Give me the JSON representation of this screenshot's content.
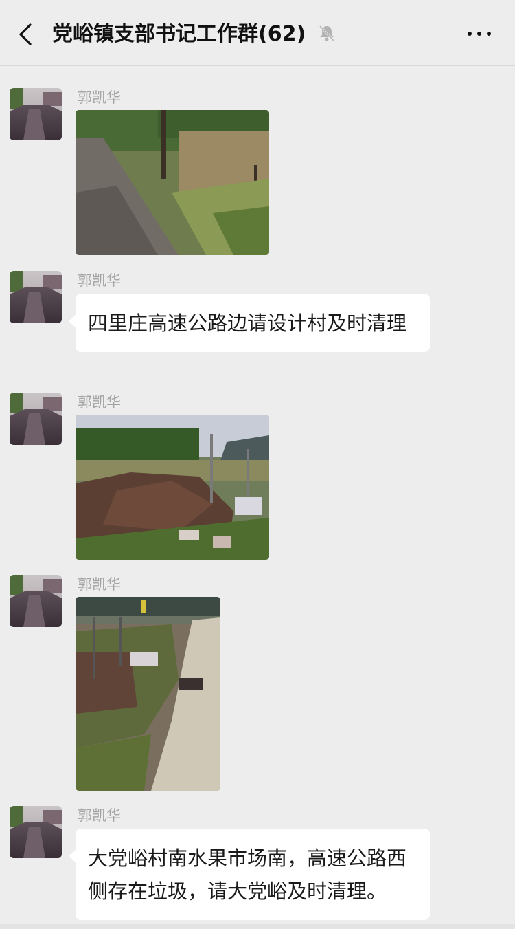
{
  "header": {
    "back_icon": "chevron-left-icon",
    "title": "党峪镇支部书记工作群(62)",
    "mute_icon": "bell-muted-icon",
    "more_icon": "ellipsis-icon"
  },
  "messages": [
    {
      "type": "image",
      "sender": "郭凯华",
      "image": "dirt road beside trees with overgrown weeds"
    },
    {
      "type": "text",
      "sender": "郭凯华",
      "text": "四里庄高速公路边请设计村及时清理"
    },
    {
      "type": "image",
      "sender": "郭凯华",
      "image": "pile of dirt and rubble with scattered trash by a fence"
    },
    {
      "type": "image",
      "sender": "郭凯华",
      "image": "concrete path with trash and rubble along the roadside"
    },
    {
      "type": "text",
      "sender": "郭凯华",
      "text": "大党峪村南水果市场南，高速公路西侧存在垃圾，请大党峪及时清理。"
    }
  ],
  "colors": {
    "background": "#ededed",
    "bubble": "#ffffff",
    "sender_name": "#a3a3a3",
    "title_text": "#111111"
  }
}
